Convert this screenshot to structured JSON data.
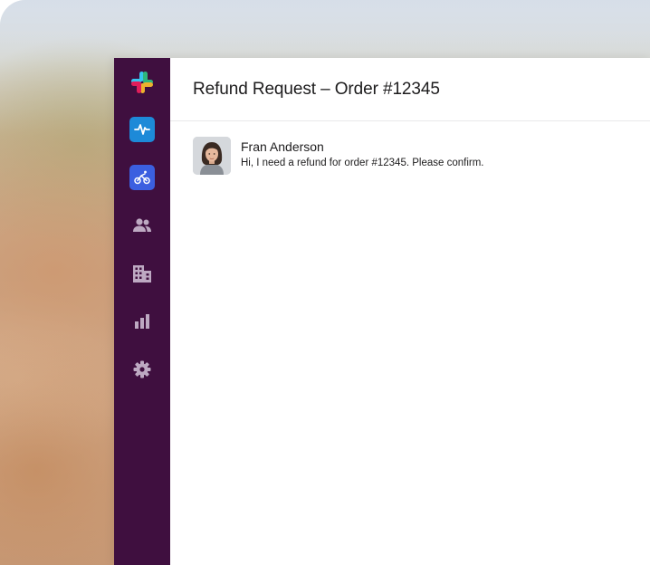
{
  "channel": {
    "title": "Refund Request – Order #12345"
  },
  "sidebar": {
    "items": [
      {
        "name": "workspace-logo",
        "icon": "slack-logo-icon"
      },
      {
        "name": "activity",
        "icon": "pulse-icon",
        "color": "#1d8ad8"
      },
      {
        "name": "delivery",
        "icon": "bike-icon",
        "color": "#3b5fe0"
      },
      {
        "name": "people",
        "icon": "people-icon"
      },
      {
        "name": "directory",
        "icon": "building-icon"
      },
      {
        "name": "analytics",
        "icon": "bar-chart-icon"
      },
      {
        "name": "settings",
        "icon": "gear-icon"
      }
    ],
    "background": "#3f0f3f"
  },
  "messages": [
    {
      "sender": "Fran Anderson",
      "text": "Hi, I need a refund for order #12345. Please confirm.",
      "avatar": "profile-photo"
    }
  ]
}
